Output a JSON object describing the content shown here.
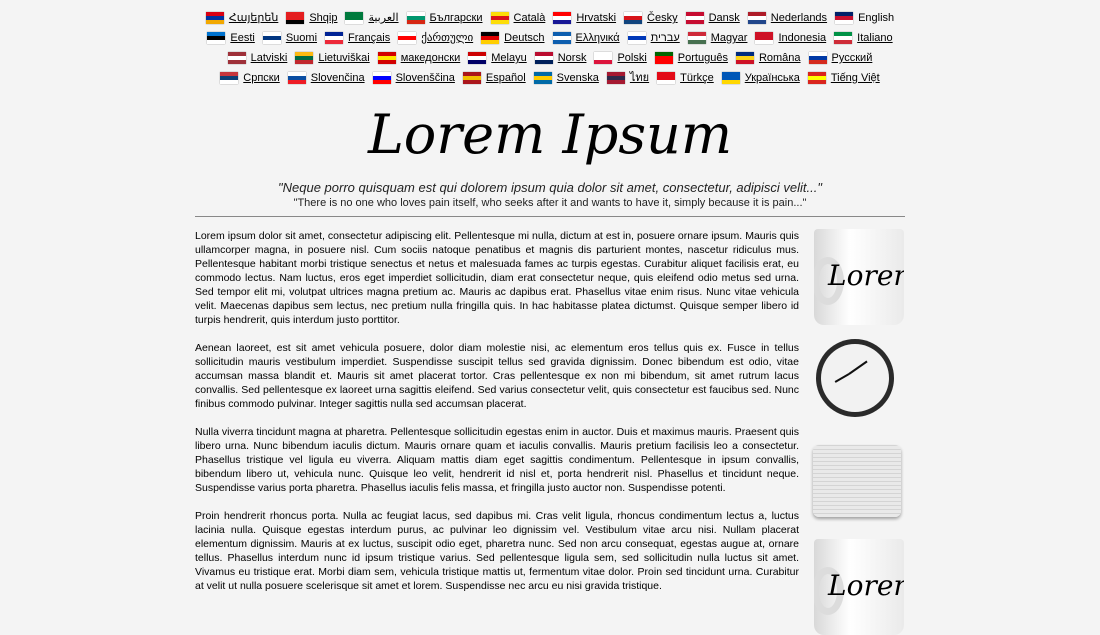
{
  "languages": [
    [
      {
        "label": "Հայերեն",
        "c": [
          "#d90012",
          "#0033a0",
          "#f2a800"
        ]
      },
      {
        "label": "Shqip",
        "c": [
          "#e41e20",
          "#e41e20",
          "#000000"
        ]
      },
      {
        "label": "العربية",
        "c": [
          "#007a3d",
          "#007a3d",
          "#ffffff"
        ]
      },
      {
        "label": "Български",
        "c": [
          "#ffffff",
          "#00966e",
          "#d62612"
        ]
      },
      {
        "label": "Català",
        "c": [
          "#fcdd09",
          "#da121a",
          "#fcdd09"
        ]
      },
      {
        "label": "Hrvatski",
        "c": [
          "#ff0000",
          "#ffffff",
          "#171796"
        ]
      },
      {
        "label": "Česky",
        "c": [
          "#ffffff",
          "#d7141a",
          "#11457e"
        ]
      },
      {
        "label": "Dansk",
        "c": [
          "#c60c30",
          "#ffffff",
          "#c60c30"
        ]
      },
      {
        "label": "Nederlands",
        "c": [
          "#ae1c28",
          "#ffffff",
          "#21468b"
        ]
      },
      {
        "label": "English",
        "c": [
          "#012169",
          "#c8102e",
          "#ffffff"
        ],
        "current": true
      }
    ],
    [
      {
        "label": "Eesti",
        "c": [
          "#0072ce",
          "#000000",
          "#ffffff"
        ]
      },
      {
        "label": "Suomi",
        "c": [
          "#ffffff",
          "#003580",
          "#ffffff"
        ]
      },
      {
        "label": "Français",
        "c": [
          "#002395",
          "#ffffff",
          "#ed2939"
        ]
      },
      {
        "label": "ქართული",
        "c": [
          "#ffffff",
          "#ff0000",
          "#ffffff"
        ]
      },
      {
        "label": "Deutsch",
        "c": [
          "#000000",
          "#dd0000",
          "#ffce00"
        ]
      },
      {
        "label": "Ελληνικά",
        "c": [
          "#0d5eaf",
          "#ffffff",
          "#0d5eaf"
        ]
      },
      {
        "label": "עברית",
        "c": [
          "#ffffff",
          "#0038b8",
          "#ffffff"
        ]
      },
      {
        "label": "Magyar",
        "c": [
          "#ce2939",
          "#ffffff",
          "#477050"
        ]
      },
      {
        "label": "Indonesia",
        "c": [
          "#ce1126",
          "#ce1126",
          "#ffffff"
        ]
      },
      {
        "label": "Italiano",
        "c": [
          "#009246",
          "#ffffff",
          "#ce2b37"
        ]
      }
    ],
    [
      {
        "label": "Latviski",
        "c": [
          "#9e3039",
          "#ffffff",
          "#9e3039"
        ]
      },
      {
        "label": "Lietuviškai",
        "c": [
          "#fdb913",
          "#006a44",
          "#c1272d"
        ]
      },
      {
        "label": "македонски",
        "c": [
          "#d20000",
          "#ffe600",
          "#d20000"
        ]
      },
      {
        "label": "Melayu",
        "c": [
          "#cc0001",
          "#ffffff",
          "#010066"
        ]
      },
      {
        "label": "Norsk",
        "c": [
          "#ba0c2f",
          "#ffffff",
          "#00205b"
        ]
      },
      {
        "label": "Polski",
        "c": [
          "#ffffff",
          "#ffffff",
          "#dc143c"
        ]
      },
      {
        "label": "Português",
        "c": [
          "#006600",
          "#ff0000",
          "#ff0000"
        ]
      },
      {
        "label": "Româna",
        "c": [
          "#002b7f",
          "#fcd116",
          "#ce1126"
        ]
      },
      {
        "label": "Русский",
        "c": [
          "#ffffff",
          "#0039a6",
          "#d52b1e"
        ]
      }
    ],
    [
      {
        "label": "Српски",
        "c": [
          "#c6363c",
          "#0c4076",
          "#ffffff"
        ]
      },
      {
        "label": "Slovenčina",
        "c": [
          "#ffffff",
          "#0b4ea2",
          "#ee1c25"
        ]
      },
      {
        "label": "Slovenščina",
        "c": [
          "#ffffff",
          "#0000ff",
          "#ff0000"
        ]
      },
      {
        "label": "Español",
        "c": [
          "#aa151b",
          "#f1bf00",
          "#aa151b"
        ]
      },
      {
        "label": "Svenska",
        "c": [
          "#006aa7",
          "#fecc00",
          "#006aa7"
        ]
      },
      {
        "label": "ไทย",
        "c": [
          "#a51931",
          "#2d2a4a",
          "#a51931"
        ]
      },
      {
        "label": "Türkçe",
        "c": [
          "#e30a17",
          "#e30a17",
          "#ffffff"
        ]
      },
      {
        "label": "Українська",
        "c": [
          "#0057b7",
          "#0057b7",
          "#ffd700"
        ]
      },
      {
        "label": "Tiếng Việt",
        "c": [
          "#da251d",
          "#ffff00",
          "#da251d"
        ]
      }
    ]
  ],
  "logo_text": "Lorem Ipsum",
  "quote_latin": "\"Neque porro quisquam est qui dolorem ipsum quia dolor sit amet, consectetur, adipisci velit...\"",
  "quote_english": "\"There is no one who loves pain itself, who seeks after it and wants to have it, simply because it is pain...\"",
  "paragraphs": [
    "Lorem ipsum dolor sit amet, consectetur adipiscing elit. Pellentesque mi nulla, dictum at est in, posuere ornare ipsum. Mauris quis ullamcorper magna, in posuere nisl. Cum sociis natoque penatibus et magnis dis parturient montes, nascetur ridiculus mus. Pellentesque habitant morbi tristique senectus et netus et malesuada fames ac turpis egestas. Curabitur aliquet facilisis erat, eu commodo lectus. Nam luctus, eros eget imperdiet sollicitudin, diam erat consectetur neque, quis eleifend odio metus sed urna. Sed tempor elit mi, volutpat ultrices magna pretium ac. Mauris ac dapibus erat. Phasellus vitae enim risus. Nunc vitae vehicula velit. Maecenas dapibus sem lectus, nec pretium nulla fringilla quis. In hac habitasse platea dictumst. Quisque semper libero id turpis hendrerit, quis interdum justo porttitor.",
    "Aenean laoreet, est sit amet vehicula posuere, dolor diam molestie nisi, ac elementum eros tellus quis ex. Fusce in tellus sollicitudin mauris vestibulum imperdiet. Suspendisse suscipit tellus sed gravida dignissim. Donec bibendum est odio, vitae accumsan massa blandit et. Mauris sit amet placerat tortor. Cras pellentesque ex non mi bibendum, sit amet rutrum lacus convallis. Sed pellentesque ex laoreet urna sagittis eleifend. Sed varius consectetur velit, quis consectetur est faucibus sed. Nunc finibus commodo pulvinar. Integer sagittis nulla sed accumsan placerat.",
    "Nulla viverra tincidunt magna at pharetra. Pellentesque sollicitudin egestas enim in auctor. Duis et maximus mauris. Praesent quis libero urna. Nunc bibendum iaculis dictum. Mauris ornare quam et iaculis convallis. Mauris pretium facilisis leo a consectetur. Phasellus tristique vel ligula eu viverra. Aliquam mattis diam eget sagittis condimentum. Pellentesque in ipsum convallis, bibendum libero ut, vehicula nunc. Quisque leo velit, hendrerit id nisl et, porta hendrerit nisl. Phasellus et tincidunt neque. Suspendisse varius porta pharetra. Phasellus iaculis felis massa, et fringilla justo auctor non. Suspendisse potenti.",
    "Proin hendrerit rhoncus porta. Nulla ac feugiat lacus, sed dapibus mi. Cras velit ligula, rhoncus condimentum lectus a, luctus lacinia nulla. Quisque egestas interdum purus, ac pulvinar leo dignissim vel. Vestibulum vitae arcu nisi. Nullam placerat elementum dignissim. Mauris at ex luctus, suscipit odio eget, pharetra nunc. Sed non arcu consequat, egestas augue at, ornare tellus. Phasellus interdum nunc id ipsum tristique varius. Sed pellentesque ligula sem, sed sollicitudin nulla luctus sit amet. Vivamus eu tristique erat. Morbi diam sem, vehicula tristique mattis ut, fermentum vitae dolor. Proin sed tincidunt urna. Curabitur at velit ut nulla posuere scelerisque sit amet et lorem. Suspendisse nec arcu eu nisi gravida tristique."
  ],
  "products": {
    "mug_text": "Lorem Ipsum",
    "mug2_text": "Lorem Ipsum"
  }
}
